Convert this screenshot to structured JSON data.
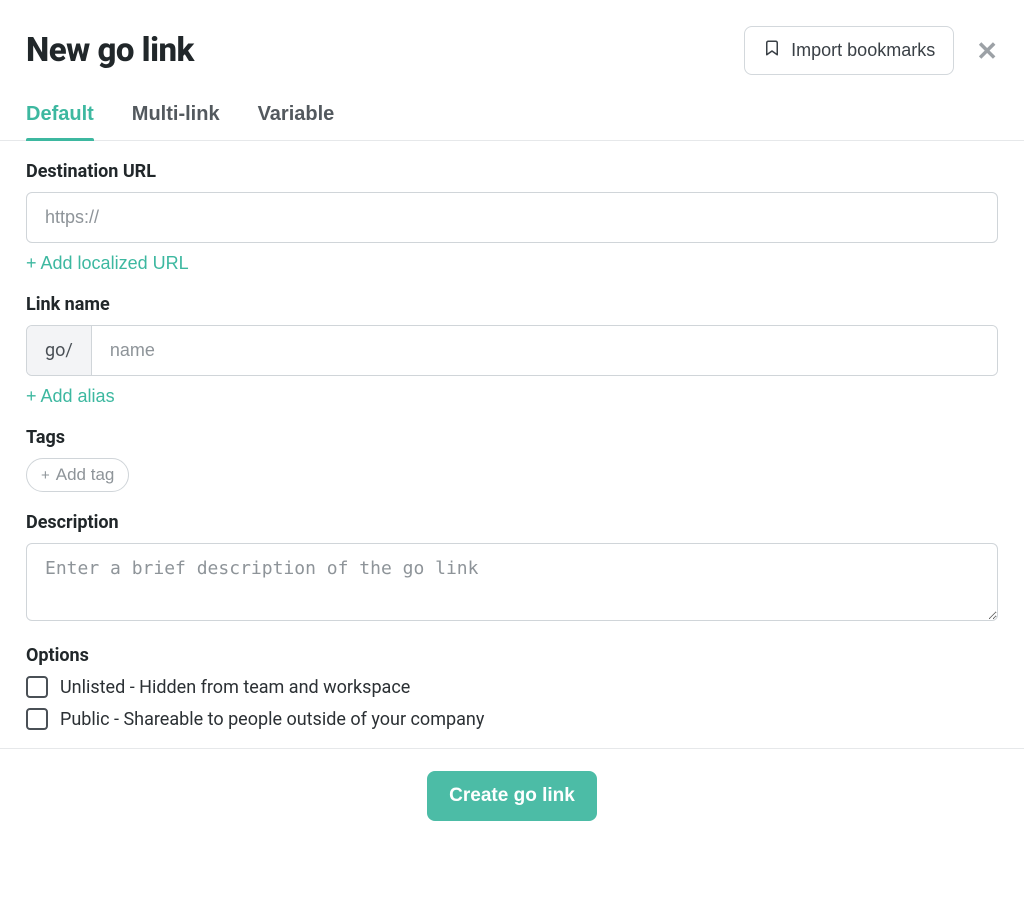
{
  "header": {
    "title": "New go link",
    "import_label": "Import bookmarks"
  },
  "tabs": {
    "default": "Default",
    "multi": "Multi-link",
    "variable": "Variable"
  },
  "dest": {
    "label": "Destination URL",
    "placeholder": "https://",
    "add_localized": "+ Add localized URL"
  },
  "link_name": {
    "label": "Link name",
    "prefix": "go/",
    "placeholder": "name",
    "add_alias": "+ Add alias"
  },
  "tags": {
    "label": "Tags",
    "add_label": "Add tag"
  },
  "description": {
    "label": "Description",
    "placeholder": "Enter a brief description of the go link"
  },
  "options": {
    "label": "Options",
    "unlisted": "Unlisted - Hidden from team and workspace",
    "public": "Public - Shareable to people outside of your company"
  },
  "footer": {
    "create": "Create go link"
  }
}
